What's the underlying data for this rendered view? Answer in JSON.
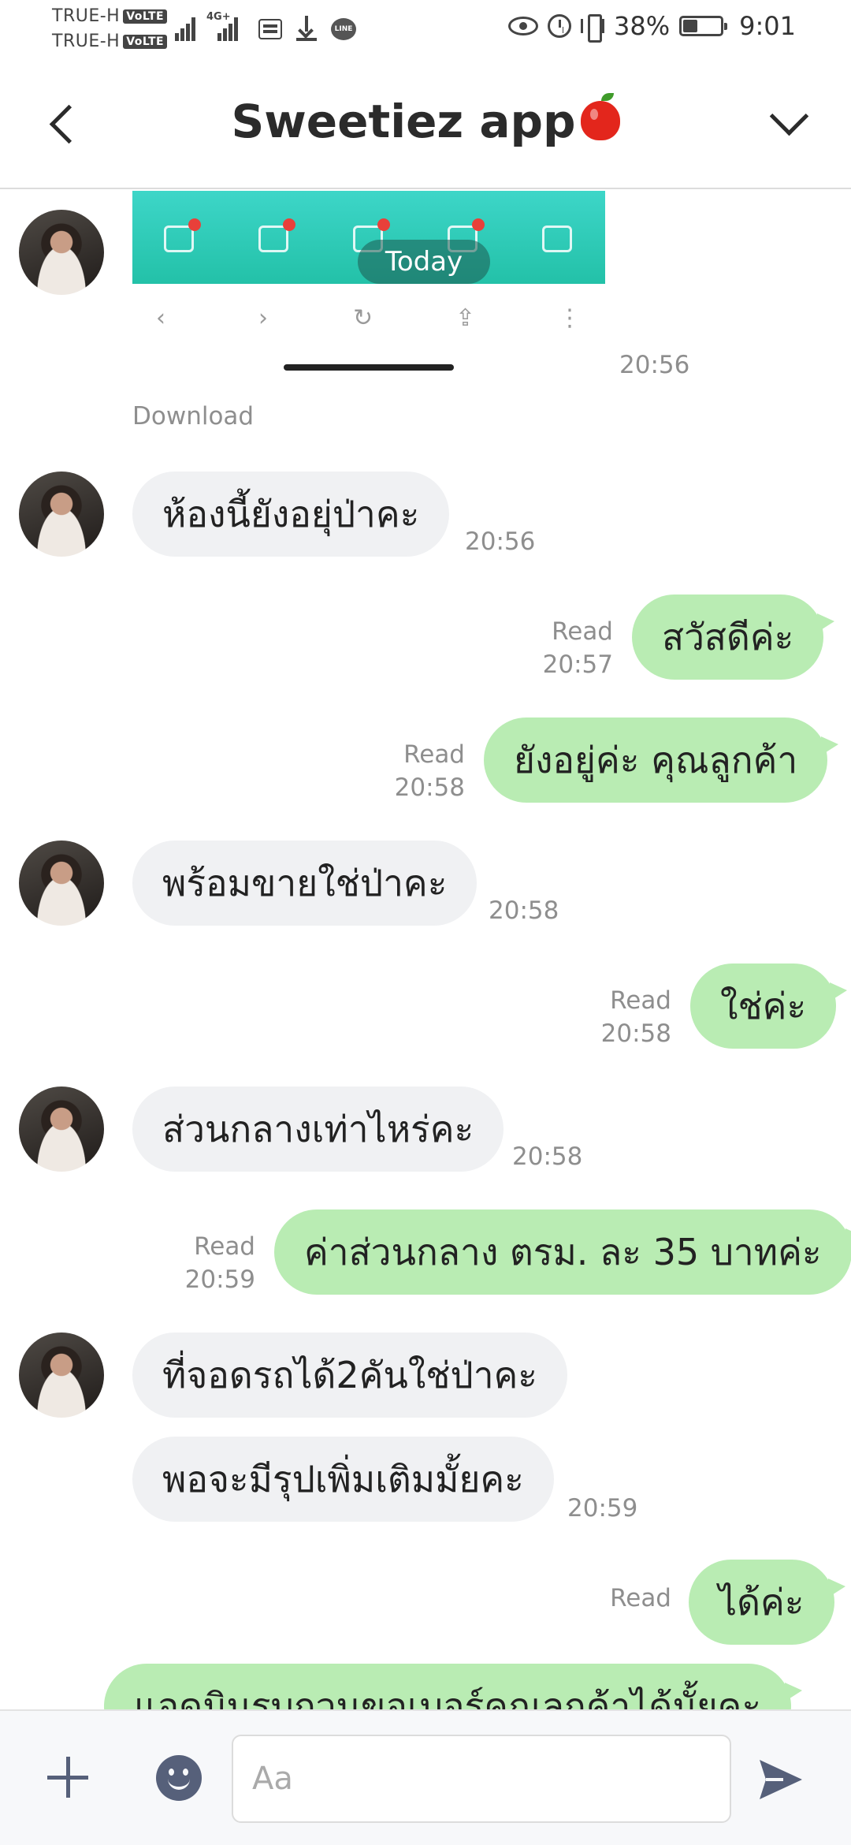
{
  "status_bar": {
    "carrier1": "TRUE-H",
    "carrier2": "TRUE-H",
    "volte": "VoLTE",
    "network": "4G+",
    "line_badge": "LINE",
    "battery_percent": "38%",
    "battery_level": 0.38,
    "time": "9:01"
  },
  "header": {
    "title": "Sweetiez app"
  },
  "chat": {
    "image_message": {
      "time": "20:56",
      "download_label": "Download"
    },
    "date_pill": "Today",
    "messages": [
      {
        "text": "ห้องนี้ยังอยุ่ป่าคะ",
        "time": "20:56"
      },
      {
        "text": "สวัสดีค่ะ",
        "read": "Read",
        "time": "20:57"
      },
      {
        "text": "ยังอยู่ค่ะ คุณลูกค้า",
        "read": "Read",
        "time": "20:58"
      },
      {
        "text": "พร้อมขายใช่ป่าคะ",
        "time": "20:58"
      },
      {
        "text": "ใช่ค่ะ",
        "read": "Read",
        "time": "20:58"
      },
      {
        "text": "ส่วนกลางเท่าไหร่คะ",
        "time": "20:58"
      },
      {
        "text": "ค่าส่วนกลาง ตรม. ละ 35 บาทค่ะ",
        "read": "Read",
        "time": "20:59"
      },
      {
        "text": "ที่จอดรถได้2คันใช่ป่าคะ"
      },
      {
        "text": "พอจะมีรุปเพิ่มเติมมั้ยคะ",
        "time": "20:59"
      },
      {
        "text": "ได้ค่ะ",
        "read": "Read"
      },
      {
        "text": "แอดมินรบกวนขอเบอร์คุณลูกค้าได้มั้ยคะ"
      }
    ]
  },
  "input_bar": {
    "placeholder": "Aa"
  },
  "colors": {
    "incoming_bubble": "#f0f1f3",
    "outgoing_bubble": "#b9ecb3",
    "icon": "#56607a"
  }
}
